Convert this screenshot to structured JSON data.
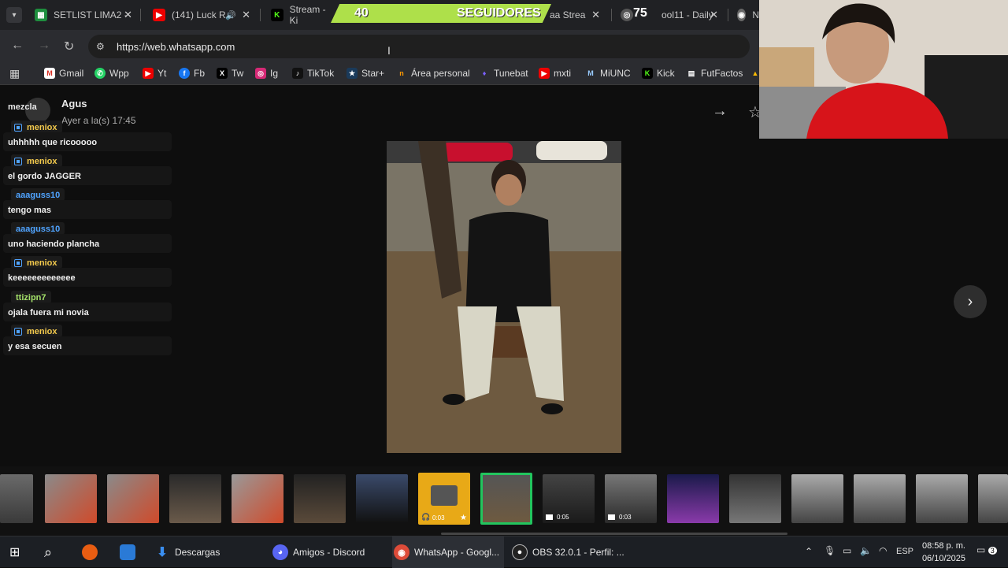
{
  "tabs": [
    {
      "label": "SETLIST LIMA2 -",
      "icon": "sheets-icon"
    },
    {
      "label": "(141) Luck R",
      "icon": "youtube-icon"
    },
    {
      "label": "Stream - Ki",
      "icon": "kick-icon"
    },
    {
      "label": "aa Strea",
      "icon": "stream-icon"
    },
    {
      "label": "ool11 - Daily",
      "icon": "daily-icon"
    },
    {
      "label": "N",
      "icon": "chrome-icon"
    }
  ],
  "overlay": {
    "followers_count": "40",
    "followers_label": "SEGUIDORES",
    "goal": "75"
  },
  "address": {
    "url": "https://web.whatsapp.com"
  },
  "bookmarks": [
    {
      "label": "Gmail"
    },
    {
      "label": "Wpp"
    },
    {
      "label": "Yt"
    },
    {
      "label": "Fb"
    },
    {
      "label": "Tw"
    },
    {
      "label": "Ig"
    },
    {
      "label": "TikTok"
    },
    {
      "label": "Star+"
    },
    {
      "label": "Área personal"
    },
    {
      "label": "Tunebat"
    },
    {
      "label": "mxti"
    },
    {
      "label": "MiUNC"
    },
    {
      "label": "Kick"
    },
    {
      "label": "FutFactos"
    }
  ],
  "viewer": {
    "sender": "Agus",
    "timestamp": "Ayer a la(s) 17:45"
  },
  "chat": [
    {
      "user": "",
      "text": "mezcla"
    },
    {
      "user": "meniox",
      "text": "uhhhhh que ricooooo"
    },
    {
      "user": "meniox",
      "text": "el gordo JAGGER"
    },
    {
      "user": "aaaguss10",
      "text": "tengo mas"
    },
    {
      "user": "aaaguss10",
      "text": "uno haciendo plancha"
    },
    {
      "user": "meniox",
      "text": "keeeeeeeeeeeee"
    },
    {
      "user": "ttizipn7",
      "text": "ojala fuera mi novia"
    },
    {
      "user": "meniox",
      "text": "y esa secuen"
    }
  ],
  "thumb_durations": {
    "audio": "0:03",
    "video1": "0:05",
    "video2": "0:03"
  },
  "taskbar": {
    "descargas": "Descargas",
    "discord": "Amigos - Discord",
    "chrome": "WhatsApp - Googl...",
    "obs": "OBS 32.0.1 - Perfil: ...",
    "lang": "ESP",
    "time": "08:58 p. m.",
    "date": "06/10/2025",
    "notif": "3"
  },
  "colors": {
    "meniox": "#f2c94c",
    "aaaguss10": "#4fa3ff",
    "ttizipn7": "#a5e26a",
    "accent": "#aee04a",
    "selected": "#22c55e"
  }
}
